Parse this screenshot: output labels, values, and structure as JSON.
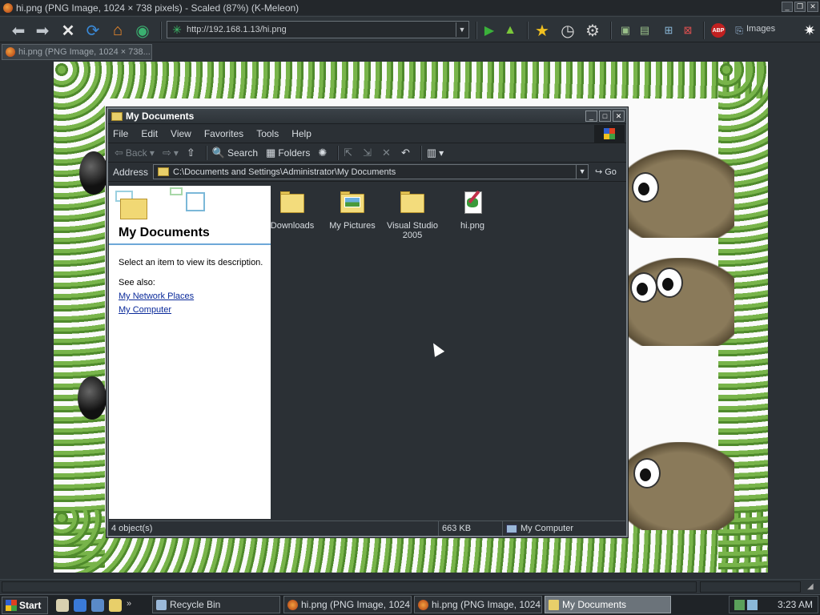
{
  "browser": {
    "title": "hi.png (PNG Image, 1024 × 738 pixels) - Scaled (87%) (K-Meleon)",
    "url": "http://192.168.1.13/hi.png",
    "images_label": "Images",
    "tab_label": "hi.png (PNG Image, 1024 × 738..."
  },
  "explorer": {
    "title": "My Documents",
    "menu": [
      "File",
      "Edit",
      "View",
      "Favorites",
      "Tools",
      "Help"
    ],
    "toolbar": {
      "back": "Back",
      "search": "Search",
      "folders": "Folders"
    },
    "address_label": "Address",
    "address_value": "C:\\Documents and Settings\\Administrator\\My Documents",
    "go_label": "Go",
    "task_pane": {
      "heading": "My Documents",
      "description": "Select an item to view its description.",
      "see_also": "See also:",
      "links": [
        "My Network Places",
        "My Computer"
      ]
    },
    "files": [
      {
        "name": "Downloads",
        "icon": "folder-icon"
      },
      {
        "name": "My Pictures",
        "icon": "pictures-folder-icon"
      },
      {
        "name": "Visual Studio 2005",
        "icon": "folder-icon"
      },
      {
        "name": "hi.png",
        "icon": "png-file-icon"
      }
    ],
    "status": {
      "count": "4 object(s)",
      "size": "663 KB",
      "location": "My Computer"
    }
  },
  "taskbar": {
    "start": "Start",
    "quick_launch_more": "»",
    "buttons": [
      {
        "label": "Recycle Bin",
        "active": false
      },
      {
        "label": "hi.png (PNG Image, 1024 ...",
        "active": false
      },
      {
        "label": "hi.png (PNG Image, 1024 ...",
        "active": false
      },
      {
        "label": "My Documents",
        "active": true
      }
    ],
    "clock": "3:23 AM"
  },
  "colors": {
    "chrome_bg": "#2b3035",
    "link": "#0a2a9a",
    "accent_rule": "#6da8d8"
  }
}
